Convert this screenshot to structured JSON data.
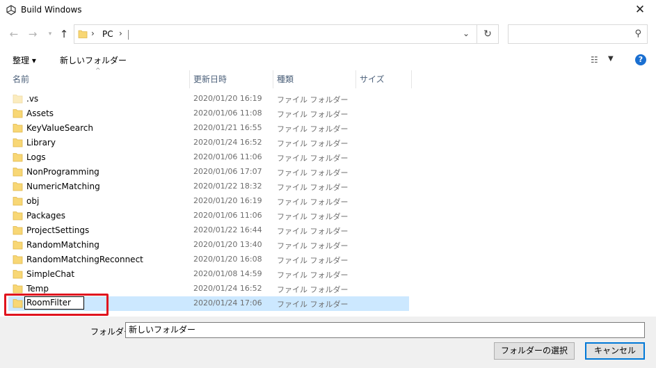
{
  "window": {
    "title": "Build Windows"
  },
  "icons": {
    "app": "unity-logo-icon",
    "close": "close-icon",
    "back": "arrow-left-icon",
    "forward": "arrow-right-icon",
    "recent": "chevron-down-icon",
    "up": "arrow-up-icon",
    "refresh": "refresh-icon",
    "search": "search-icon",
    "help": "help-icon",
    "folder": "folder-icon"
  },
  "address": {
    "crumb": "PC"
  },
  "search": {
    "placeholder": ""
  },
  "toolbar": {
    "organize": "整理 ▾",
    "new_folder": "新しいフォルダー",
    "help": "?"
  },
  "columns": {
    "name": "名前",
    "date": "更新日時",
    "type": "種類",
    "size": "サイズ"
  },
  "files": [
    {
      "name": ".vs",
      "date": "2020/01/20 16:19",
      "type": "ファイル フォルダー",
      "faded": true
    },
    {
      "name": "Assets",
      "date": "2020/01/06 11:08",
      "type": "ファイル フォルダー"
    },
    {
      "name": "KeyValueSearch",
      "date": "2020/01/21 16:55",
      "type": "ファイル フォルダー"
    },
    {
      "name": "Library",
      "date": "2020/01/24 16:52",
      "type": "ファイル フォルダー"
    },
    {
      "name": "Logs",
      "date": "2020/01/06 11:06",
      "type": "ファイル フォルダー"
    },
    {
      "name": "NonProgramming",
      "date": "2020/01/06 17:07",
      "type": "ファイル フォルダー"
    },
    {
      "name": "NumericMatching",
      "date": "2020/01/22 18:32",
      "type": "ファイル フォルダー"
    },
    {
      "name": "obj",
      "date": "2020/01/20 16:19",
      "type": "ファイル フォルダー"
    },
    {
      "name": "Packages",
      "date": "2020/01/06 11:06",
      "type": "ファイル フォルダー"
    },
    {
      "name": "ProjectSettings",
      "date": "2020/01/22 16:44",
      "type": "ファイル フォルダー"
    },
    {
      "name": "RandomMatching",
      "date": "2020/01/20 13:40",
      "type": "ファイル フォルダー"
    },
    {
      "name": "RandomMatchingReconnect",
      "date": "2020/01/20 16:08",
      "type": "ファイル フォルダー"
    },
    {
      "name": "SimpleChat",
      "date": "2020/01/08 14:59",
      "type": "ファイル フォルダー"
    },
    {
      "name": "Temp",
      "date": "2020/01/24 16:52",
      "type": "ファイル フォルダー"
    },
    {
      "name": "RoomFilter",
      "date": "2020/01/24 17:06",
      "type": "ファイル フォルダー",
      "selected": true,
      "renaming": true
    }
  ],
  "footer": {
    "folder_label": "フォルダー:",
    "folder_value": "新しいフォルダー",
    "select_button": "フォルダーの選択",
    "cancel_button": "キャンセル"
  },
  "colors": {
    "selection": "#cce8ff",
    "highlight_box": "#e0141e",
    "accent": "#0078d7",
    "folder": "#f8d775"
  }
}
